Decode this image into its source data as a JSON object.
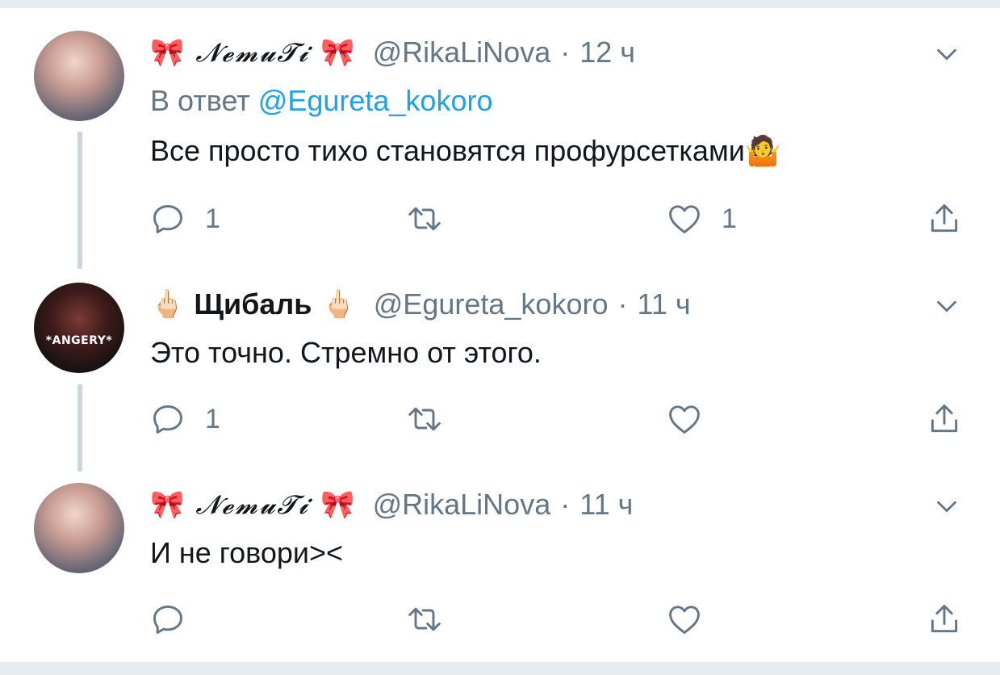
{
  "tweets": [
    {
      "display_name": "𝓝𝓮𝓶𝓾𝓣𝓲",
      "name_emoji_left": "🎀",
      "name_emoji_right": "🎀",
      "handle": "@RikaLiNova",
      "separator": "·",
      "time": "12 ч",
      "reply_prefix": "В ответ",
      "reply_mention": "@Egureta_kokoro",
      "text": "Все просто тихо становятся профурсетками🤷",
      "reply_count": "1",
      "like_count": "1"
    },
    {
      "display_name": "Щибаль",
      "name_emoji_left": "🖕🏻",
      "name_emoji_right": "🖕🏻",
      "avatar_caption": "*ANGERY*",
      "handle": "@Egureta_kokoro",
      "separator": "·",
      "time": "11 ч",
      "text": "Это точно. Стремно от этого.",
      "reply_count": "1",
      "like_count": ""
    },
    {
      "display_name": "𝓝𝓮𝓶𝓾𝓣𝓲",
      "name_emoji_left": "🎀",
      "name_emoji_right": "🎀",
      "handle": "@RikaLiNova",
      "separator": "·",
      "time": "11 ч",
      "text": "И не говори><",
      "reply_count": "",
      "like_count": ""
    }
  ],
  "icons": {
    "reply": "reply-icon",
    "retweet": "retweet-icon",
    "like": "heart-icon",
    "share": "share-icon",
    "more": "chevron-down-icon"
  },
  "colors": {
    "link": "#1da1f2",
    "secondary": "#657786",
    "text": "#14171a",
    "thread_line": "#ccd6dd"
  }
}
